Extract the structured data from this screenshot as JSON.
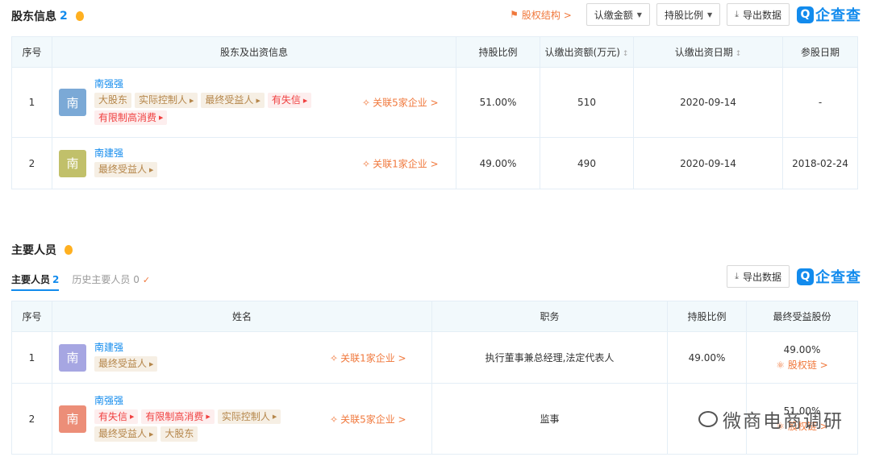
{
  "shareholders": {
    "title": "股东信息",
    "count": "2",
    "equity_structure_link": "股权结构 >",
    "btn_subscribed_amount": "认缴金额",
    "btn_share_ratio": "持股比例",
    "btn_export": "导出数据",
    "logo_text": "企查查",
    "logo_mark": "Q",
    "columns": [
      "序号",
      "股东及出资信息",
      "持股比例",
      "认缴出资额(万元)",
      "认缴出资日期",
      "参股日期"
    ],
    "rows": [
      {
        "index": "1",
        "avatar": "南",
        "avatar_color": "#7ba9d6",
        "name": "南强强",
        "tags": [
          {
            "text": "大股东",
            "style": "beige",
            "arrow": false
          },
          {
            "text": "实际控制人",
            "style": "beige",
            "arrow": true
          },
          {
            "text": "最终受益人",
            "style": "beige",
            "arrow": true
          },
          {
            "text": "有失信",
            "style": "red",
            "arrow": true
          },
          {
            "text": "有限制高消费",
            "style": "red",
            "arrow": true
          }
        ],
        "related": "关联5家企业 >",
        "ratio": "51.00%",
        "subscribed": "510",
        "date": "2020-09-14",
        "join_date": "-"
      },
      {
        "index": "2",
        "avatar": "南",
        "avatar_color": "#c1c06a",
        "name": "南建强",
        "tags": [
          {
            "text": "最终受益人",
            "style": "beige",
            "arrow": true
          }
        ],
        "related": "关联1家企业 >",
        "ratio": "49.00%",
        "subscribed": "490",
        "date": "2020-09-14",
        "join_date": "2018-02-24"
      }
    ]
  },
  "personnel": {
    "title": "主要人员",
    "tab_active": "主要人员",
    "tab_active_count": "2",
    "tab_history": "历史主要人员 0",
    "btn_export": "导出数据",
    "logo_text": "企查查",
    "logo_mark": "Q",
    "columns": [
      "序号",
      "姓名",
      "职务",
      "持股比例",
      "最终受益股份"
    ],
    "rows": [
      {
        "index": "1",
        "avatar": "南",
        "avatar_color": "#a6a6e2",
        "name": "南建强",
        "tags": [
          {
            "text": "最终受益人",
            "style": "beige",
            "arrow": true
          }
        ],
        "related": "关联1家企业 >",
        "position": "执行董事兼总经理,法定代表人",
        "ratio": "49.00%",
        "benefit": "49.00%",
        "chain": "股权链 >"
      },
      {
        "index": "2",
        "avatar": "南",
        "avatar_color": "#ec8e78",
        "name": "南强强",
        "tags": [
          {
            "text": "有失信",
            "style": "red",
            "arrow": true
          },
          {
            "text": "有限制高消费",
            "style": "red",
            "arrow": true
          },
          {
            "text": "实际控制人",
            "style": "beige",
            "arrow": true
          },
          {
            "text": "最终受益人",
            "style": "beige",
            "arrow": true
          },
          {
            "text": "大股东",
            "style": "beige",
            "arrow": false
          }
        ],
        "related": "关联5家企业 >",
        "position": "监事",
        "ratio": "",
        "benefit": "51.00%",
        "chain": "股权链 >"
      }
    ]
  },
  "watermark": "微商电商调研"
}
